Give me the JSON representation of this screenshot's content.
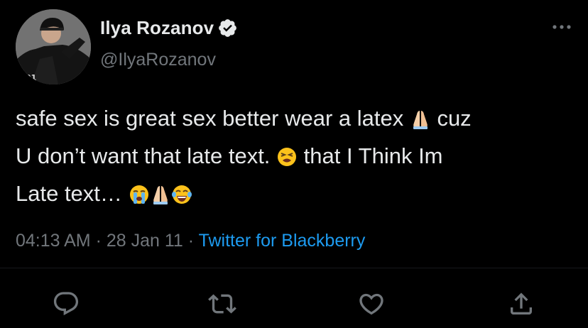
{
  "author": {
    "display_name": "Ilya Rozanov",
    "handle": "@IlyaRozanov",
    "verified": true,
    "avatar_icon": "hockey-player-avatar"
  },
  "tweet": {
    "lines": [
      {
        "pre": "safe sex is great sex better wear a latex ",
        "post": " cuz"
      },
      {
        "pre": "U don’t want that late text. ",
        "post": " that I Think Im"
      },
      {
        "pre": "Late text… ",
        "post": ""
      }
    ],
    "emoji": [
      "folded-hands",
      "tired-face",
      "loudly-crying-face",
      "folded-hands",
      "face-with-tears-of-joy"
    ]
  },
  "meta": {
    "time": "04:13 AM",
    "sep1": " · ",
    "date": "28 Jan 11",
    "sep2": " · ",
    "source": "Twitter for Blackberry"
  },
  "colors": {
    "background": "#000000",
    "text": "#e7e9ea",
    "secondary": "#71767b",
    "accent": "#1d9bf0"
  },
  "actions": [
    "reply-icon",
    "retweet-icon",
    "like-icon",
    "share-icon"
  ]
}
